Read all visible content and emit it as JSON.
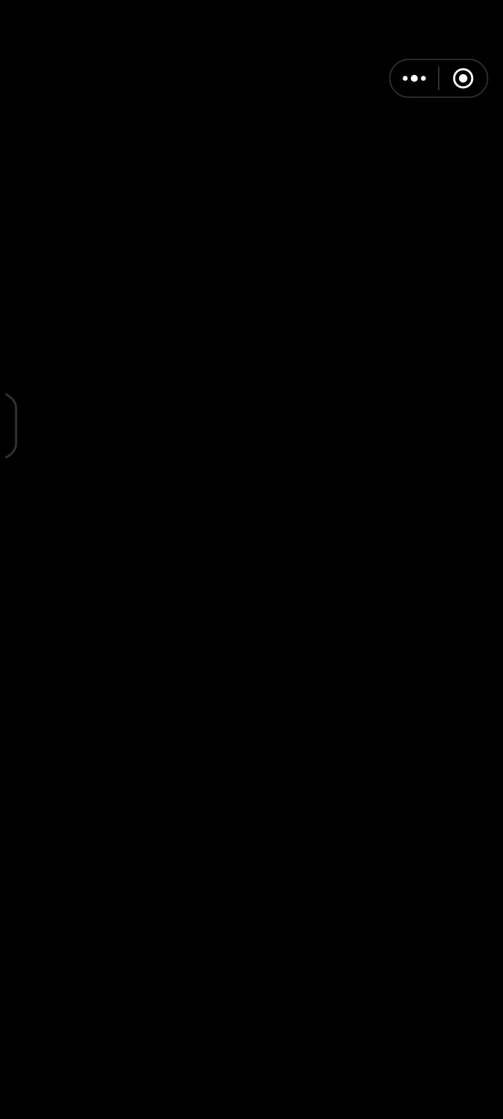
{
  "theme": {
    "background": "#000000",
    "capsule_border": "#2e2e2e",
    "icon_color": "#ffffff",
    "handle_color": "#333333"
  },
  "capsule": {
    "more_icon": "more-dots-icon",
    "close_icon": "target-circle-icon"
  },
  "side_handle": {
    "icon": "edge-bracket-icon"
  }
}
